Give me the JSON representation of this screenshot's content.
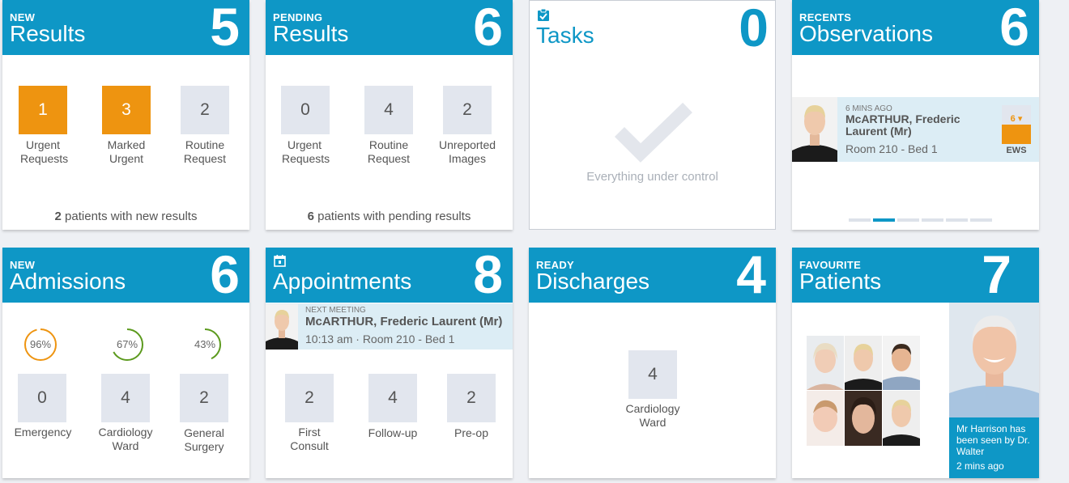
{
  "colors": {
    "accent": "#0e97c6",
    "urgent": "#ee9410",
    "tile": "#e2e6ee",
    "info_bg": "#dcedf5"
  },
  "new_results": {
    "kicker": "NEW",
    "title": "Results",
    "count": "5",
    "tiles": [
      {
        "value": "1",
        "label": "Urgent Requests",
        "urgent": true
      },
      {
        "value": "3",
        "label": "Marked Urgent",
        "urgent": true
      },
      {
        "value": "2",
        "label": "Routine Request",
        "urgent": false
      }
    ],
    "footer_count": "2",
    "footer_text": " patients with new results"
  },
  "pending_results": {
    "kicker": "PENDING",
    "title": "Results",
    "count": "6",
    "tiles": [
      {
        "value": "0",
        "label": "Urgent Requests"
      },
      {
        "value": "4",
        "label": "Routine Request"
      },
      {
        "value": "2",
        "label": "Unreported Images"
      }
    ],
    "footer_count": "6",
    "footer_text": " patients with pending results"
  },
  "tasks": {
    "title": "Tasks",
    "count": "0",
    "message": "Everything under control",
    "icon": "checklist-icon"
  },
  "observations": {
    "kicker": "RECENTS",
    "title": "Observations",
    "count": "6",
    "time": "6 MINS AGO",
    "patient": "McARTHUR, Frederic Laurent (Mr)",
    "location": "Room 210 - Bed 1",
    "ews_value": "6",
    "ews_label": "EWS",
    "pager_count": 6,
    "pager_active": 1
  },
  "admissions": {
    "kicker": "NEW",
    "title": "Admissions",
    "count": "6",
    "rings": [
      {
        "percent": 96,
        "label": "96%",
        "color": "#ee9410"
      },
      {
        "percent": 67,
        "label": "67%",
        "color": "#5c9a1e"
      },
      {
        "percent": 43,
        "label": "43%",
        "color": "#5c9a1e"
      }
    ],
    "tiles": [
      {
        "value": "0",
        "label": "Emergency"
      },
      {
        "value": "4",
        "label": "Cardiology Ward"
      },
      {
        "value": "2",
        "label": "General Surgery"
      }
    ]
  },
  "appointments": {
    "title": "Appointments",
    "count": "8",
    "icon": "calendar-icon",
    "next_label": "NEXT MEETING",
    "patient": "McARTHUR, Frederic Laurent (Mr)",
    "details": "10:13 am · Room 210 - Bed 1",
    "tiles": [
      {
        "value": "2",
        "label": "First Consult"
      },
      {
        "value": "4",
        "label": "Follow-up"
      },
      {
        "value": "2",
        "label": "Pre-op"
      }
    ]
  },
  "discharges": {
    "kicker": "READY",
    "title": "Discharges",
    "count": "4",
    "tile": {
      "value": "4",
      "label": "Cardiology Ward"
    }
  },
  "favourites": {
    "kicker": "FAVOURITE",
    "title": "Patients",
    "count": "7",
    "note": "Mr Harrison has been seen by Dr. Walter",
    "note_time": "2 mins ago"
  }
}
